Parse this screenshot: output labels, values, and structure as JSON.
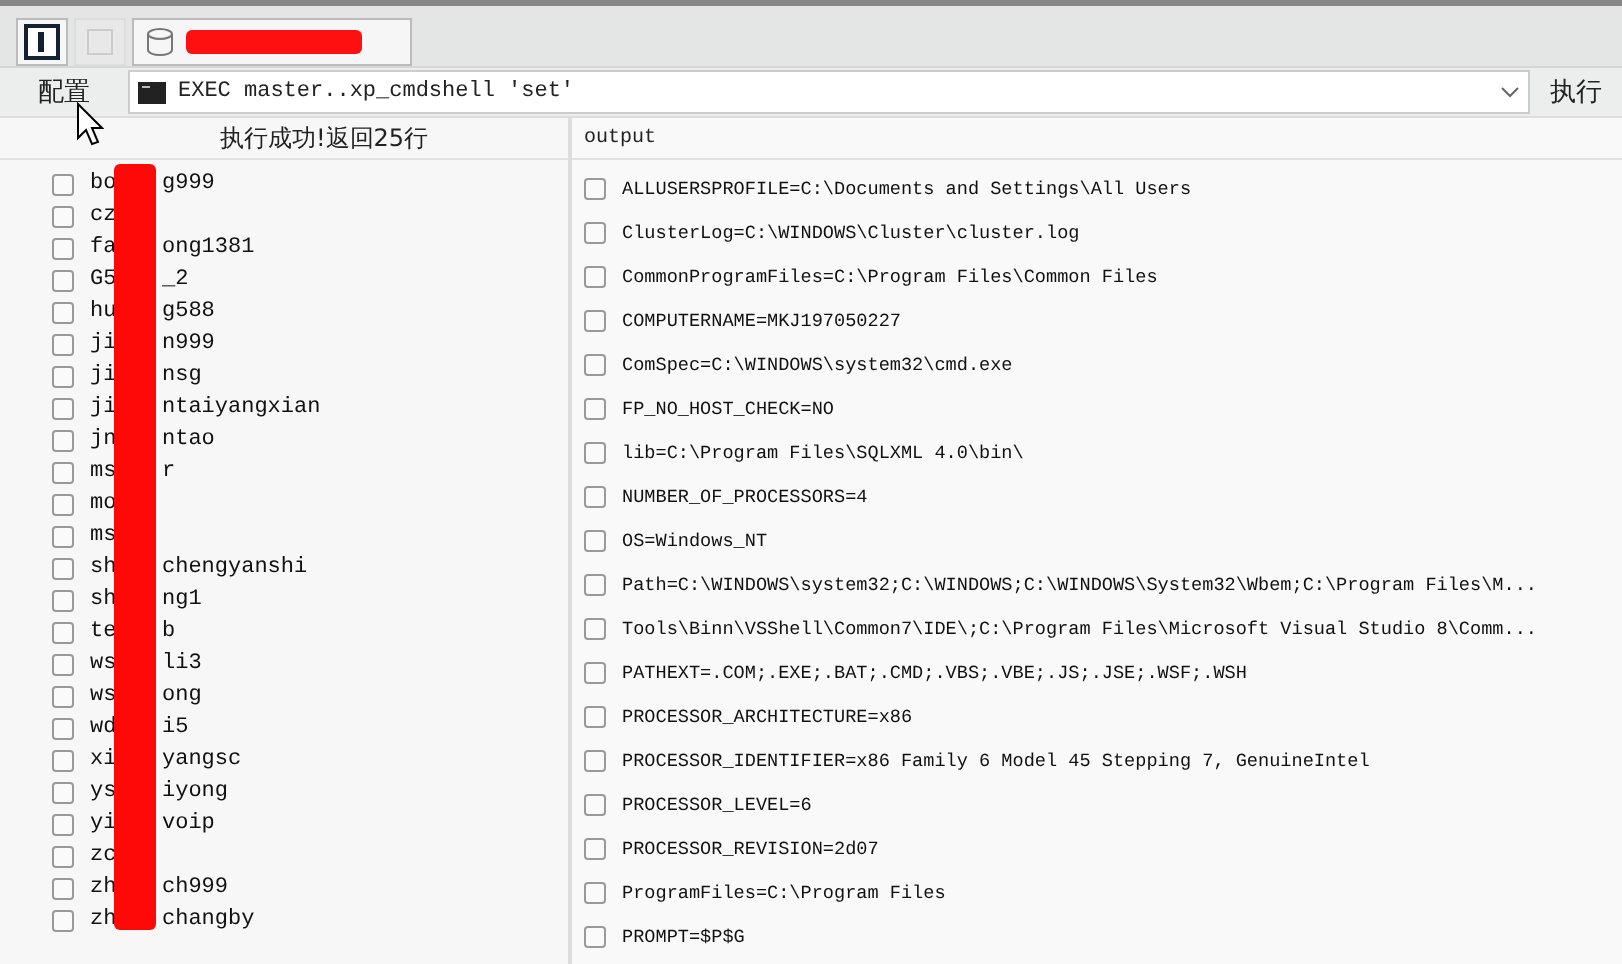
{
  "tabs": [
    {
      "kind": "panel-toggle",
      "selected": true
    },
    {
      "kind": "blank",
      "selected": false
    },
    {
      "kind": "connection",
      "selected": true,
      "redacted": true
    }
  ],
  "toolbar": {
    "config_label": "配置",
    "query": "EXEC master..xp_cmdshell 'set'",
    "run_label": "执行"
  },
  "left": {
    "status": "执行成功!返回25行",
    "redacted": true,
    "items": [
      {
        "start": "bo",
        "end": "g999",
        "checked": false
      },
      {
        "start": "cz",
        "checked": false
      },
      {
        "start": "fa",
        "end": "ong1381",
        "checked": false
      },
      {
        "start": "G5",
        "end": "_2",
        "checked": false
      },
      {
        "start": "hu",
        "end": "g588",
        "checked": false
      },
      {
        "start": "ji",
        "end": "n999",
        "checked": false
      },
      {
        "start": "ji",
        "end": "nsg",
        "checked": false
      },
      {
        "start": "ji",
        "end": "ntaiyangxian",
        "checked": false
      },
      {
        "start": "jn",
        "end": "ntao",
        "checked": false
      },
      {
        "start": "ms",
        "end": "r",
        "checked": false
      },
      {
        "start": "mo",
        "checked": false
      },
      {
        "start": "ms",
        "checked": false
      },
      {
        "start": "sh",
        "end": "chengyanshi",
        "checked": false
      },
      {
        "start": "sh",
        "end": "ng1",
        "checked": false
      },
      {
        "start": "te",
        "end": "b",
        "checked": false
      },
      {
        "start": "ws",
        "end": "li3",
        "checked": false
      },
      {
        "start": "ws",
        "end": "ong",
        "checked": false
      },
      {
        "start": "wd",
        "end": "i5",
        "checked": false
      },
      {
        "start": "xi",
        "end": "yangsc",
        "checked": false
      },
      {
        "start": "ys",
        "end": "iyong",
        "checked": false
      },
      {
        "start": "yi",
        "end": "voip",
        "checked": false
      },
      {
        "start": "zc",
        "checked": false
      },
      {
        "start": "zh",
        "end": "ch999",
        "checked": false
      },
      {
        "start": "zh",
        "end": "changby",
        "checked": false
      }
    ]
  },
  "output": {
    "header": "output",
    "rows": [
      {
        "text": "ALLUSERSPROFILE=C:\\Documents and Settings\\All Users",
        "checked": false
      },
      {
        "text": "ClusterLog=C:\\WINDOWS\\Cluster\\cluster.log",
        "checked": false
      },
      {
        "text": "CommonProgramFiles=C:\\Program Files\\Common Files",
        "checked": false
      },
      {
        "text": "COMPUTERNAME=MKJ197050227",
        "checked": false
      },
      {
        "text": "ComSpec=C:\\WINDOWS\\system32\\cmd.exe",
        "checked": false
      },
      {
        "text": "FP_NO_HOST_CHECK=NO",
        "checked": false
      },
      {
        "text": "lib=C:\\Program Files\\SQLXML 4.0\\bin\\",
        "checked": false
      },
      {
        "text": "NUMBER_OF_PROCESSORS=4",
        "checked": false
      },
      {
        "text": "OS=Windows_NT",
        "checked": false
      },
      {
        "text": "Path=C:\\WINDOWS\\system32;C:\\WINDOWS;C:\\WINDOWS\\System32\\Wbem;C:\\Program Files\\M...",
        "checked": false
      },
      {
        "text": "Tools\\Binn\\VSShell\\Common7\\IDE\\;C:\\Program Files\\Microsoft Visual Studio 8\\Comm...",
        "checked": false
      },
      {
        "text": "PATHEXT=.COM;.EXE;.BAT;.CMD;.VBS;.VBE;.JS;.JSE;.WSF;.WSH",
        "checked": false
      },
      {
        "text": "PROCESSOR_ARCHITECTURE=x86",
        "checked": false
      },
      {
        "text": "PROCESSOR_IDENTIFIER=x86 Family 6 Model 45 Stepping 7, GenuineIntel",
        "checked": false
      },
      {
        "text": "PROCESSOR_LEVEL=6",
        "checked": false
      },
      {
        "text": "PROCESSOR_REVISION=2d07",
        "checked": false
      },
      {
        "text": "ProgramFiles=C:\\Program Files",
        "checked": false
      },
      {
        "text": "PROMPT=$P$G",
        "checked": false
      }
    ]
  }
}
